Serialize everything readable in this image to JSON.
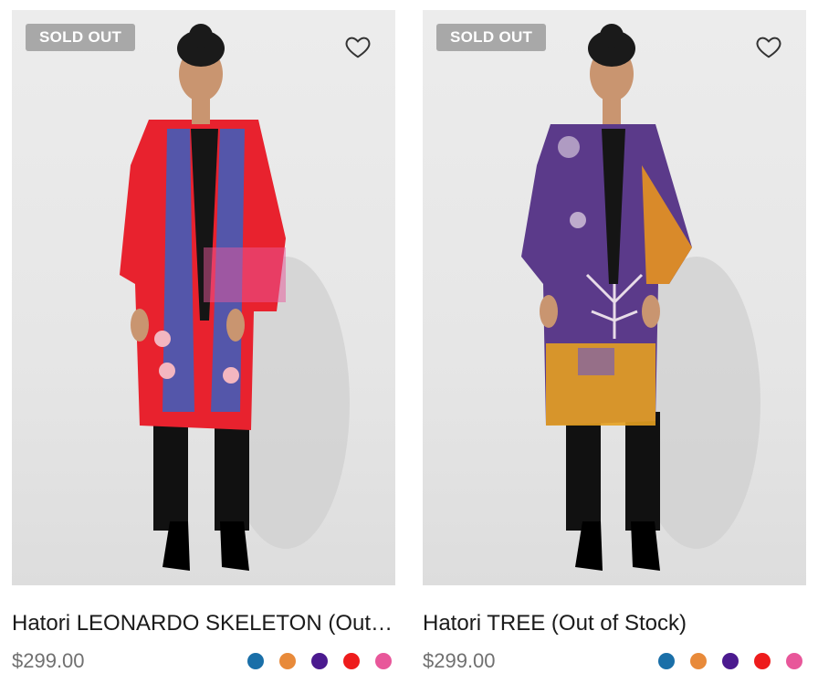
{
  "products": [
    {
      "badge": "SOLD OUT",
      "wishlist_icon": "heart-outline-icon",
      "title": "Hatori LEONARDO SKELETON (Out of Stock)",
      "price": "$299.00",
      "swatches": [
        "#1a6fa8",
        "#e88a3a",
        "#4b1a8f",
        "#ee1c1c",
        "#e8579a"
      ]
    },
    {
      "badge": "SOLD OUT",
      "wishlist_icon": "heart-outline-icon",
      "title": "Hatori TREE (Out of Stock)",
      "price": "$299.00",
      "swatches": [
        "#1a6fa8",
        "#e88a3a",
        "#4b1a8f",
        "#ee1c1c",
        "#e8579a"
      ]
    }
  ]
}
